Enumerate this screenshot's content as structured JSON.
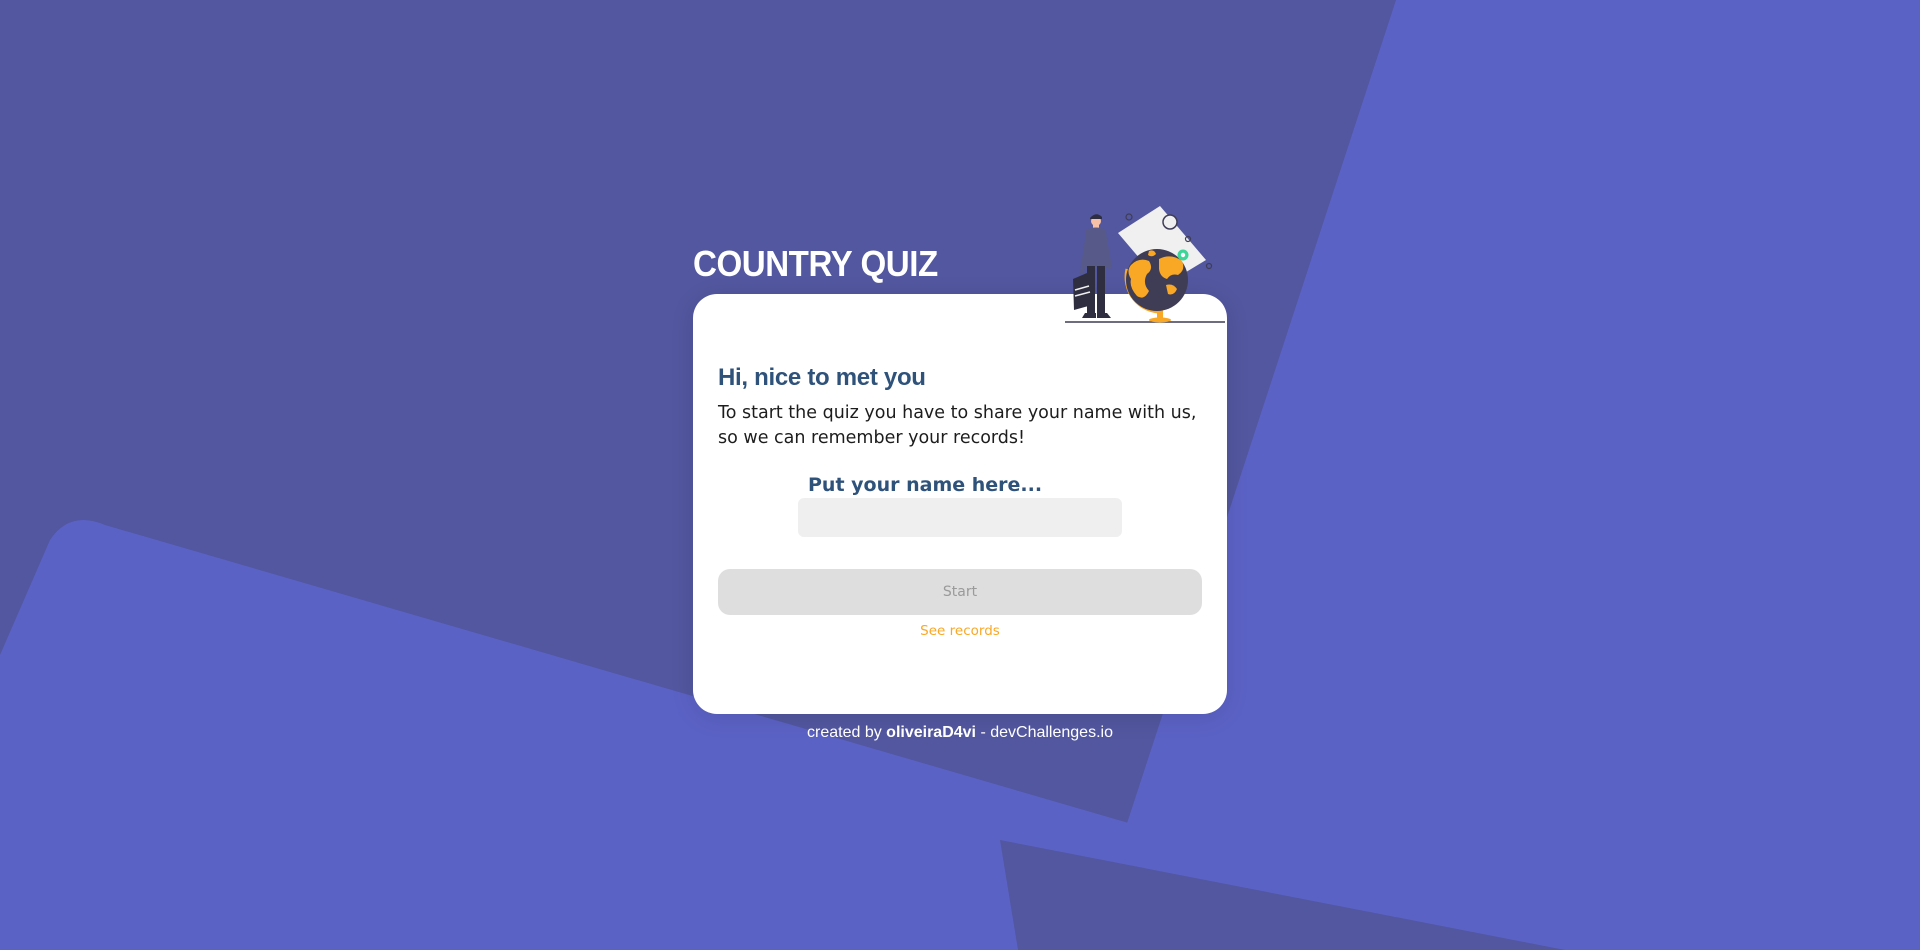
{
  "app": {
    "title": "COUNTRY QUIZ"
  },
  "card": {
    "greeting": "Hi, nice to met you",
    "intro": "To start the quiz you have to share your name with us, so we can remember your records!",
    "name_label": "Put your name here...",
    "name_input_value": "",
    "start_label": "Start",
    "records_link": "See records"
  },
  "footer": {
    "prefix": "created by",
    "author": "oliveiraD4vi",
    "suffix": "- devChallenges.io"
  },
  "illustration": {
    "icon": "traveler-with-globe-illustration"
  },
  "colors": {
    "background": "#52579f",
    "background_shape": "#5b62c5",
    "card": "#ffffff",
    "heading": "#2f527b",
    "accent": "#f9a826",
    "button_disabled": "#dedede",
    "input_bg": "#efefef"
  }
}
